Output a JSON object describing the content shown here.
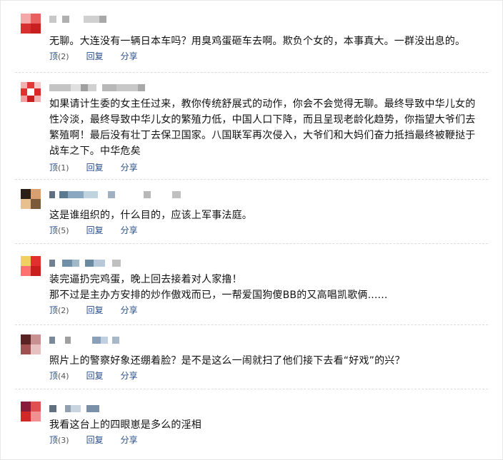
{
  "comments": [
    {
      "text": "无聊。大连没有一辆日本车吗？用臭鸡蛋砸车去啊。欺负个女的，本事真大。一群没出息的。",
      "like_label": "顶",
      "like_count": "(2)",
      "reply_label": "回复",
      "share_label": "分享",
      "avatar_colors": [
        "#d93a3a",
        "#f08080",
        "#c02020",
        "#ffffff"
      ]
    },
    {
      "text": "如果请计生委的女主任过来，教你传统舒展式的动作，你会不会觉得无聊。最终导致中华儿女的性冷淡，最终导致中华儿女的繁殖力低，中国人口下降，而且呈现老龄化趋势，你指望大爷们去繁殖啊！最后没有壮丁去保卫国家。八国联军再次侵入，大爷们和大妈们奋力抵挡最终被鞭挞于战车之下。中华危矣",
      "like_label": "顶",
      "like_count": "(1)",
      "reply_label": "回复",
      "share_label": "分享",
      "avatar_colors": [
        "#e02a2a",
        "#ffffff",
        "#c81e1e",
        "#f4a0a0"
      ]
    },
    {
      "text": "这是谁组织的，什么目的，应该上军事法庭。",
      "like_label": "顶",
      "like_count": "(5)",
      "reply_label": "回复",
      "share_label": "分享",
      "avatar_colors": [
        "#3a2a1e",
        "#c89058",
        "#7a5a3a",
        "#e8c090"
      ]
    },
    {
      "text": "装完逼扔完鸡蛋，晚上回去接着对人家撸！\n那不过是主办方安排的炒作傲戏而已，一帮爱国狗傻BB的又高唱凯歌俩......",
      "like_label": "顶",
      "like_count": "(2)",
      "reply_label": "回复",
      "share_label": "分享",
      "avatar_colors": [
        "#d82020",
        "#f0c020",
        "#ff6060",
        "#ffffff"
      ]
    },
    {
      "text": "照片上的警察好象还绷着脸？是不是这么一闹就扫了他们接下去看“好戏”的兴？",
      "like_label": "顶",
      "like_count": "(4)",
      "reply_label": "回复",
      "share_label": "分享",
      "avatar_colors": [
        "#6a2a2a",
        "#c08080",
        "#a05050",
        "#e0b0b0"
      ]
    },
    {
      "text": "我看这台上的四眼崽是多么的淫相",
      "like_label": "顶",
      "like_count": "(3)",
      "reply_label": "回复",
      "share_label": "分享",
      "avatar_colors": [
        "#b02020",
        "#e05050",
        "#8a1a3a",
        "#f09090"
      ]
    }
  ]
}
